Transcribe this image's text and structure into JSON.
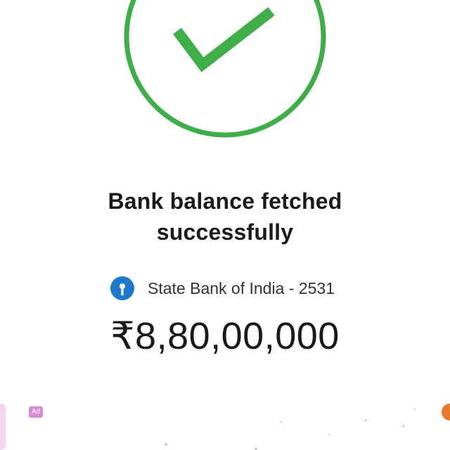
{
  "status": {
    "title_line1": "Bank balance fetched",
    "title_line2": "successfully",
    "icon": "check-circle-icon",
    "accent_color": "#3fae49"
  },
  "account": {
    "bank_name": "State Bank of India - 2531",
    "logo_icon": "sbi-logo-icon",
    "logo_color": "#1d7acb"
  },
  "balance": {
    "amount": "₹8,80,00,000"
  },
  "ad": {
    "badge_label": "Ad"
  }
}
